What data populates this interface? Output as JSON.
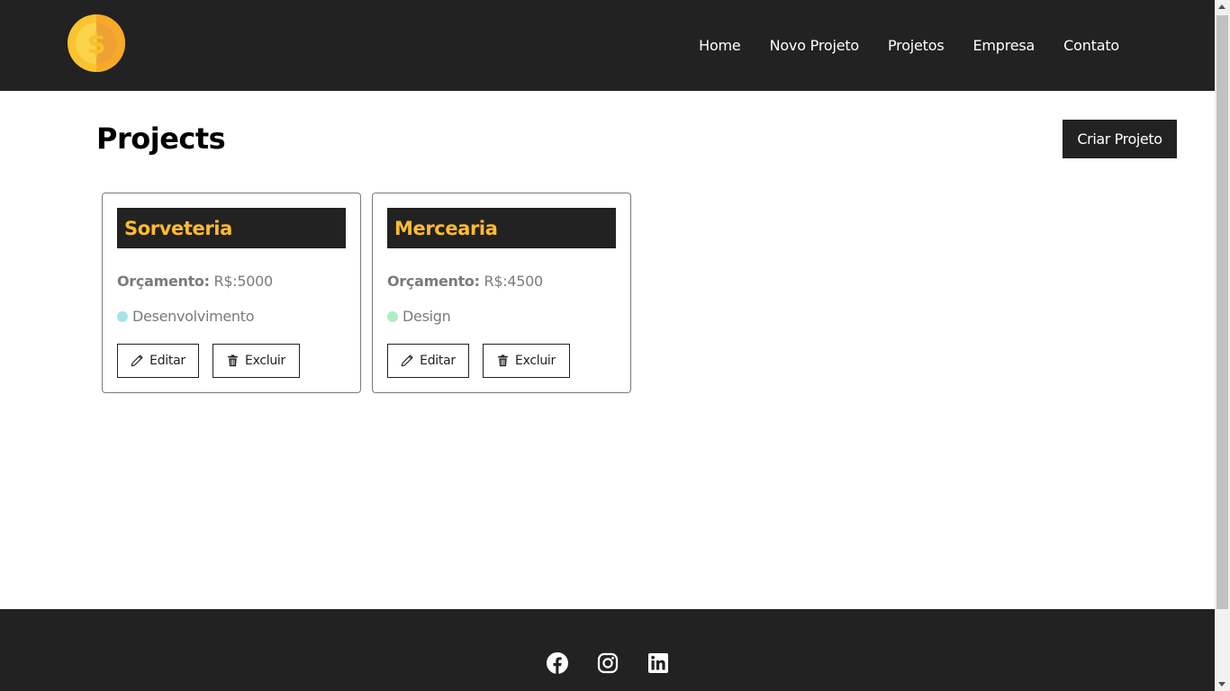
{
  "navbar": {
    "logo_icon": "dollar-coin-icon",
    "links": [
      {
        "label": "Home"
      },
      {
        "label": "Novo Projeto"
      },
      {
        "label": "Projetos"
      },
      {
        "label": "Empresa"
      },
      {
        "label": "Contato"
      }
    ]
  },
  "main": {
    "title": "Projects",
    "create_button": "Criar Projeto"
  },
  "projects": [
    {
      "name": "Sorveteria",
      "budget_label": "Orçamento:",
      "budget_value": "R$:5000",
      "category": "Desenvolvimento",
      "category_color": "#a3e4e8",
      "edit_label": "Editar",
      "delete_label": "Excluir"
    },
    {
      "name": "Mercearia",
      "budget_label": "Orçamento:",
      "budget_value": "R$:4500",
      "category": "Design",
      "category_color": "#aeedc5",
      "edit_label": "Editar",
      "delete_label": "Excluir"
    }
  ],
  "footer": {
    "social": [
      "facebook-icon",
      "instagram-icon",
      "linkedin-icon"
    ]
  },
  "colors": {
    "primary_dark": "#222222",
    "accent": "#ffbb33",
    "text_muted": "#7b7b7b"
  }
}
